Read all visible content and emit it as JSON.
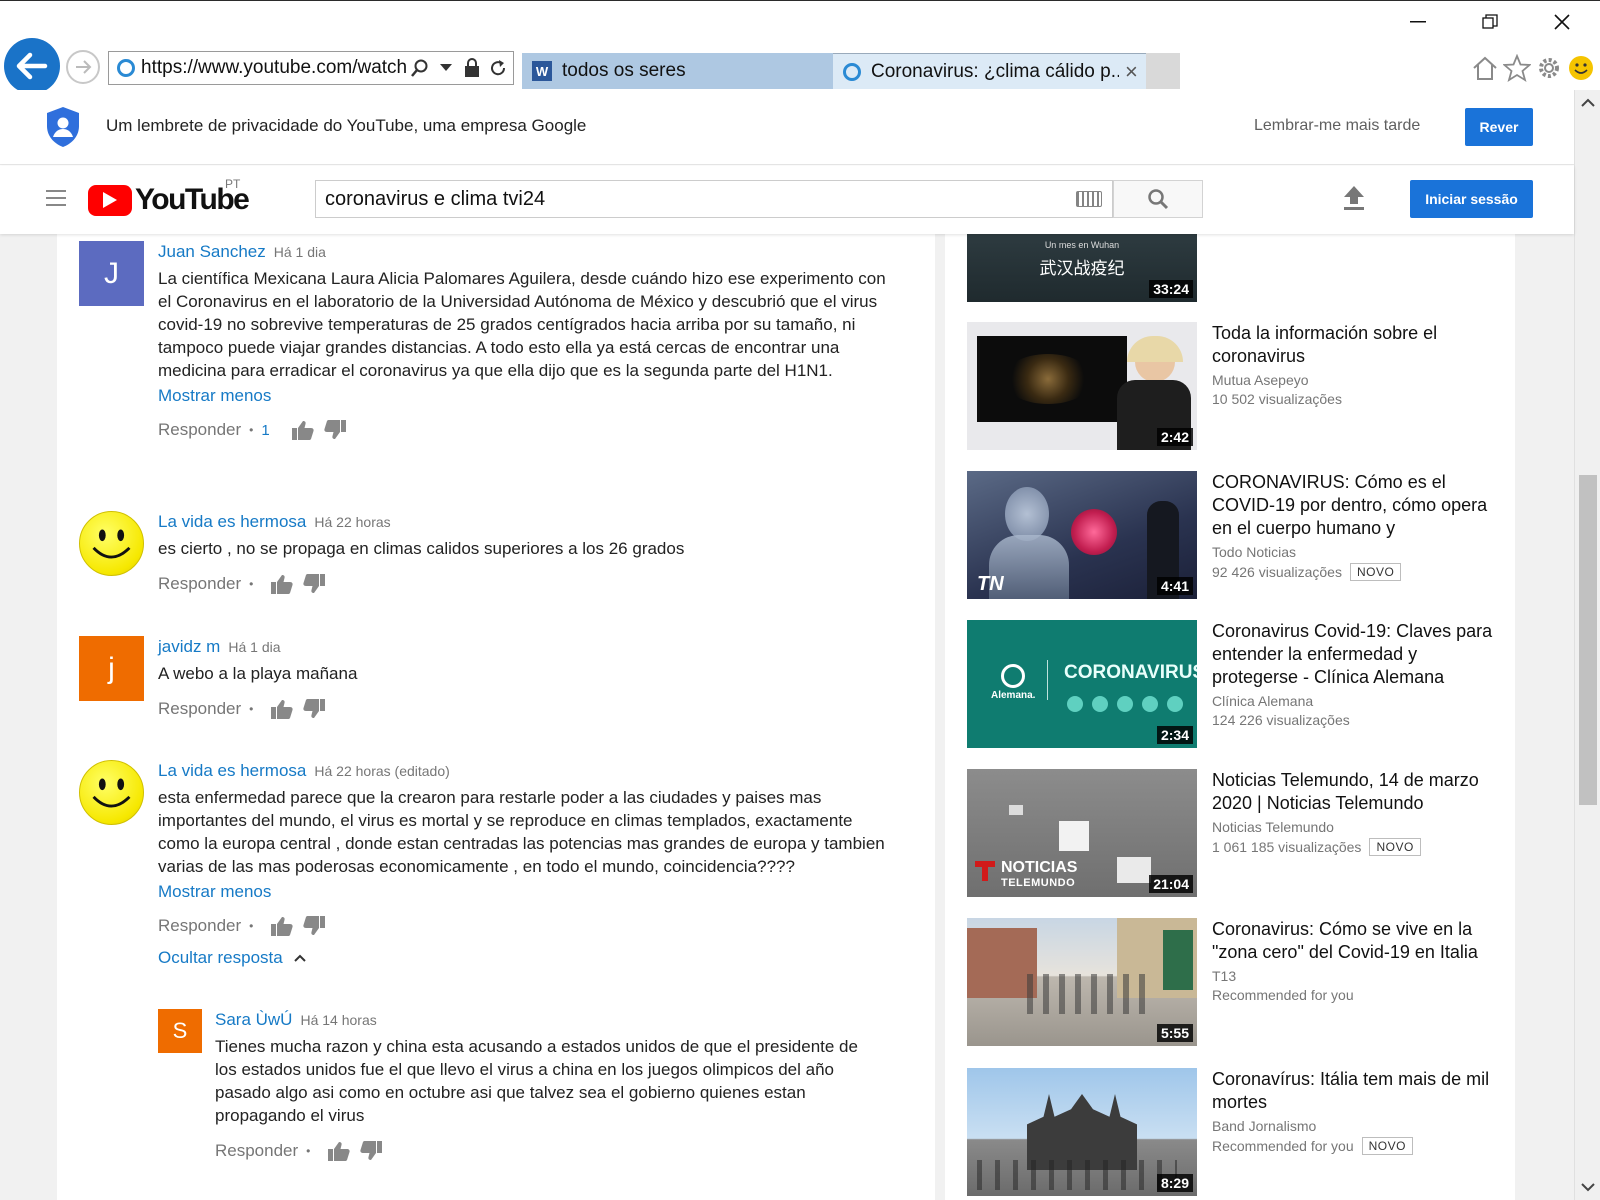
{
  "browser": {
    "url": "https://www.youtube.com/watch",
    "tabs": [
      {
        "label": "todos os seres",
        "icon": "word-icon"
      },
      {
        "label": "Coronavirus: ¿clima cálido p...",
        "icon": "ie-icon"
      }
    ],
    "tab_close": "×"
  },
  "privacy": {
    "message": "Um lembrete de privacidade do YouTube, uma empresa Google",
    "later": "Lembrar-me mais tarde",
    "review": "Rever"
  },
  "header": {
    "logo_text": "YouTube",
    "country": "PT",
    "search_value": "coronavirus e clima tvi24",
    "signin": "Iniciar sessão"
  },
  "comments": [
    {
      "author": "Juan Sanchez",
      "time": "Há 1 dia",
      "avatar_letter": "J",
      "avatar_color": "#5c6bc0",
      "text": "La científica Mexicana Laura Alicia Palomares Aguilera, desde cuándo hizo ese experimento con el Coronavirus en el laboratorio de la Universidad Autónoma de México y descubrió que el virus covid-19 no sobrevive temperaturas de 25 grados centígrados hacia arriba por su tamaño, ni tampoco puede viajar grandes distancias.  A todo esto ella ya está cercas de encontrar una medicina para erradicar el coronavirus ya que ella dijo que es la segunda parte del H1N1.",
      "more": "Mostrar menos",
      "reply": "Responder",
      "likes": "1"
    },
    {
      "author": "La vida es hermosa",
      "time": "Há 22 horas",
      "text": "es cierto , no se propaga en climas calidos superiores a los 26 grados",
      "reply": "Responder"
    },
    {
      "author": "javidz m",
      "time": "Há 1 dia",
      "avatar_letter": "j",
      "avatar_color": "#ef6c00",
      "text": "A webo a la playa mañana",
      "reply": "Responder"
    },
    {
      "author": "La vida es hermosa",
      "time": "Há 22 horas (editado)",
      "text": "esta enfermedad parece que la crearon para restarle  poder a las ciudades y paises mas importantes del mundo, el virus es mortal y se reproduce en climas templados, exactamente como la europa central , donde estan  centradas las potencias mas grandes de europa y tambien  varias de las mas poderosas economicamente , en todo el mundo, coincidencia????",
      "more": "Mostrar menos",
      "reply": "Responder",
      "hide_replies": "Ocultar resposta"
    },
    {
      "author": "Sara ÙwÚ",
      "time": "Há 14 horas",
      "avatar_letter": "S",
      "avatar_color": "#ef6c00",
      "text": "Tienes mucha razon y china esta acusando a estados unidos de que el presidente de los estados unidos fue el que llevo el virus a china en los juegos olimpicos del año pasado algo asi como en octubre asi que talvez sea el gobierno quienes estan propagando el virus",
      "reply": "Responder"
    }
  ],
  "related": [
    {
      "title": "",
      "channel": "",
      "meta": "",
      "duration": "33:24",
      "overlay_top": "Un mes en Wuhan",
      "overlay_cn": "武汉战疫纪"
    },
    {
      "title": "Toda la información sobre el coronavirus",
      "channel": "Mutua Asepeyo",
      "meta": "10 502 visualizações",
      "duration": "2:42"
    },
    {
      "title": "CORONAVIRUS: Cómo es el COVID-19 por dentro, cómo opera en el cuerpo humano y",
      "channel": "Todo Noticias",
      "meta": "92 426 visualizações",
      "badge": "NOVO",
      "duration": "4:41",
      "overlay_logo": "TN"
    },
    {
      "title": "Coronavirus Covid-19: Claves para entender la enfermedad y protegerse - Clínica Alemana",
      "channel": "Clínica Alemana",
      "meta": "124 226 visualizações",
      "duration": "2:34",
      "overlay_word": "CORONAVIRUS",
      "overlay_brand": "Alemana."
    },
    {
      "title": "Noticias Telemundo, 14 de marzo 2020 | Noticias Telemundo",
      "channel": "Noticias Telemundo",
      "meta": "1 061 185 visualizações",
      "badge": "NOVO",
      "duration": "21:04",
      "overlay_word": "NOTICIAS",
      "overlay_brand": "TELEMUNDO"
    },
    {
      "title": "Coronavirus: Cómo se vive en la \"zona cero\" del Covid-19 en Italia",
      "channel": "T13",
      "meta": "Recommended for you",
      "duration": "5:55"
    },
    {
      "title": "Coronavírus: Itália tem mais de mil mortes",
      "channel": "Band Jornalismo",
      "meta": "Recommended for you",
      "badge": "NOVO",
      "duration": "8:29"
    }
  ],
  "colors": {
    "link_blue": "#167ac6",
    "brand_red": "#ff0000",
    "button_blue": "#1a73d9"
  }
}
